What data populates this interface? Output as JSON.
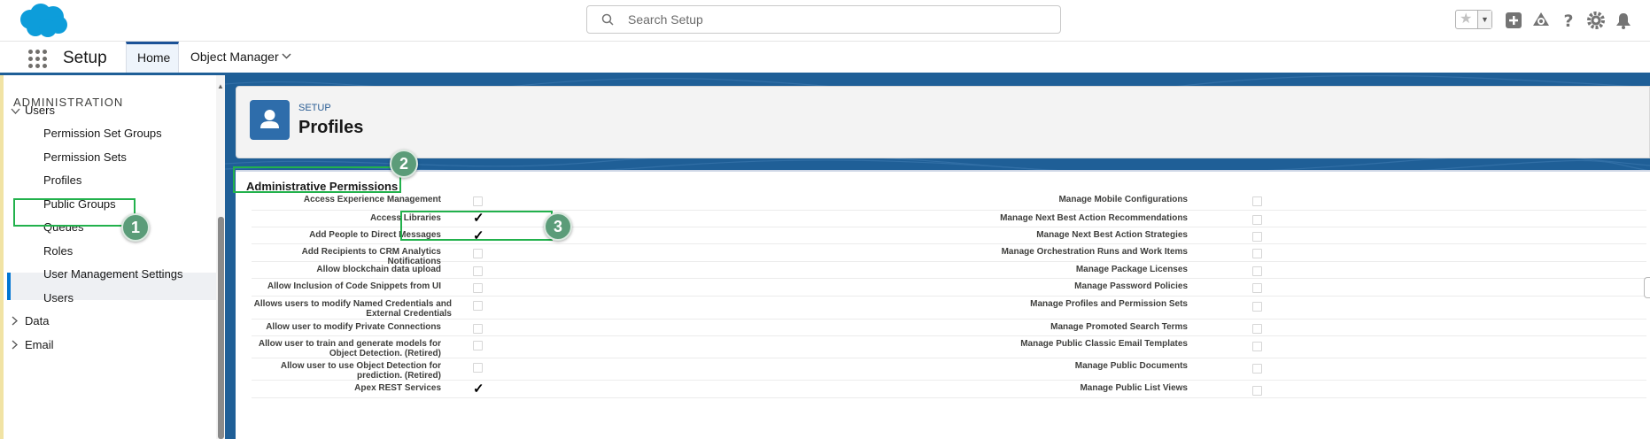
{
  "header": {
    "search_placeholder": "Search Setup",
    "icons": [
      "salesforce-cloud-logo",
      "search-icon",
      "favorites-star-icon",
      "global-actions-icon",
      "trailhead-icon",
      "help-icon",
      "setup-gear-icon",
      "notifications-bell-icon"
    ]
  },
  "nav": {
    "app_name": "Setup",
    "tabs": [
      {
        "label": "Home",
        "active": true
      },
      {
        "label": "Object Manager",
        "active": false
      }
    ]
  },
  "sidebar": {
    "section_title": "ADMINISTRATION",
    "users_group": "Users",
    "items": [
      {
        "label": "Permission Set Groups"
      },
      {
        "label": "Permission Sets"
      },
      {
        "label": "Profiles",
        "selected": true
      },
      {
        "label": "Public Groups"
      },
      {
        "label": "Queues"
      },
      {
        "label": "Roles"
      },
      {
        "label": "User Management Settings"
      },
      {
        "label": "Users"
      }
    ],
    "collapsed_groups": [
      "Data",
      "Email"
    ]
  },
  "page": {
    "breadcrumb": "SETUP",
    "title": "Profiles",
    "section_title": "Administrative Permissions"
  },
  "permissions": [
    {
      "left": "Access Experience Management",
      "left_checked": false,
      "right": "Manage Mobile Configurations",
      "right_checked": false
    },
    {
      "left": "Access Libraries",
      "left_checked": true,
      "right": "Manage Next Best Action Recommendations",
      "right_checked": false
    },
    {
      "left": "Add People to Direct Messages",
      "left_checked": true,
      "right": "Manage Next Best Action Strategies",
      "right_checked": false
    },
    {
      "left": "Add Recipients to CRM Analytics Notifications",
      "left_checked": false,
      "right": "Manage Orchestration Runs and Work Items",
      "right_checked": false
    },
    {
      "left": "Allow blockchain data upload",
      "left_checked": false,
      "right": "Manage Package Licenses",
      "right_checked": false
    },
    {
      "left": "Allow Inclusion of Code Snippets from UI",
      "left_checked": false,
      "right": "Manage Password Policies",
      "right_checked": false
    },
    {
      "left": "Allows users to modify Named Credentials and External Credentials",
      "left_checked": false,
      "right": "Manage Profiles and Permission Sets",
      "right_checked": false
    },
    {
      "left": "Allow user to modify Private Connections",
      "left_checked": false,
      "right": "Manage Promoted Search Terms",
      "right_checked": false
    },
    {
      "left": "Allow user to train and generate models for Object Detection. (Retired)",
      "left_checked": false,
      "right": "Manage Public Classic Email Templates",
      "right_checked": false
    },
    {
      "left": "Allow user to use Object Detection for prediction. (Retired)",
      "left_checked": false,
      "right": "Manage Public Documents",
      "right_checked": false
    },
    {
      "left": "Apex REST Services",
      "left_checked": true,
      "right": "Manage Public List Views",
      "right_checked": false
    }
  ],
  "annotations": [
    {
      "number": "1",
      "target": "Profiles"
    },
    {
      "number": "2",
      "target": "Administrative Permissions"
    },
    {
      "number": "3",
      "target": "Access Libraries"
    }
  ]
}
